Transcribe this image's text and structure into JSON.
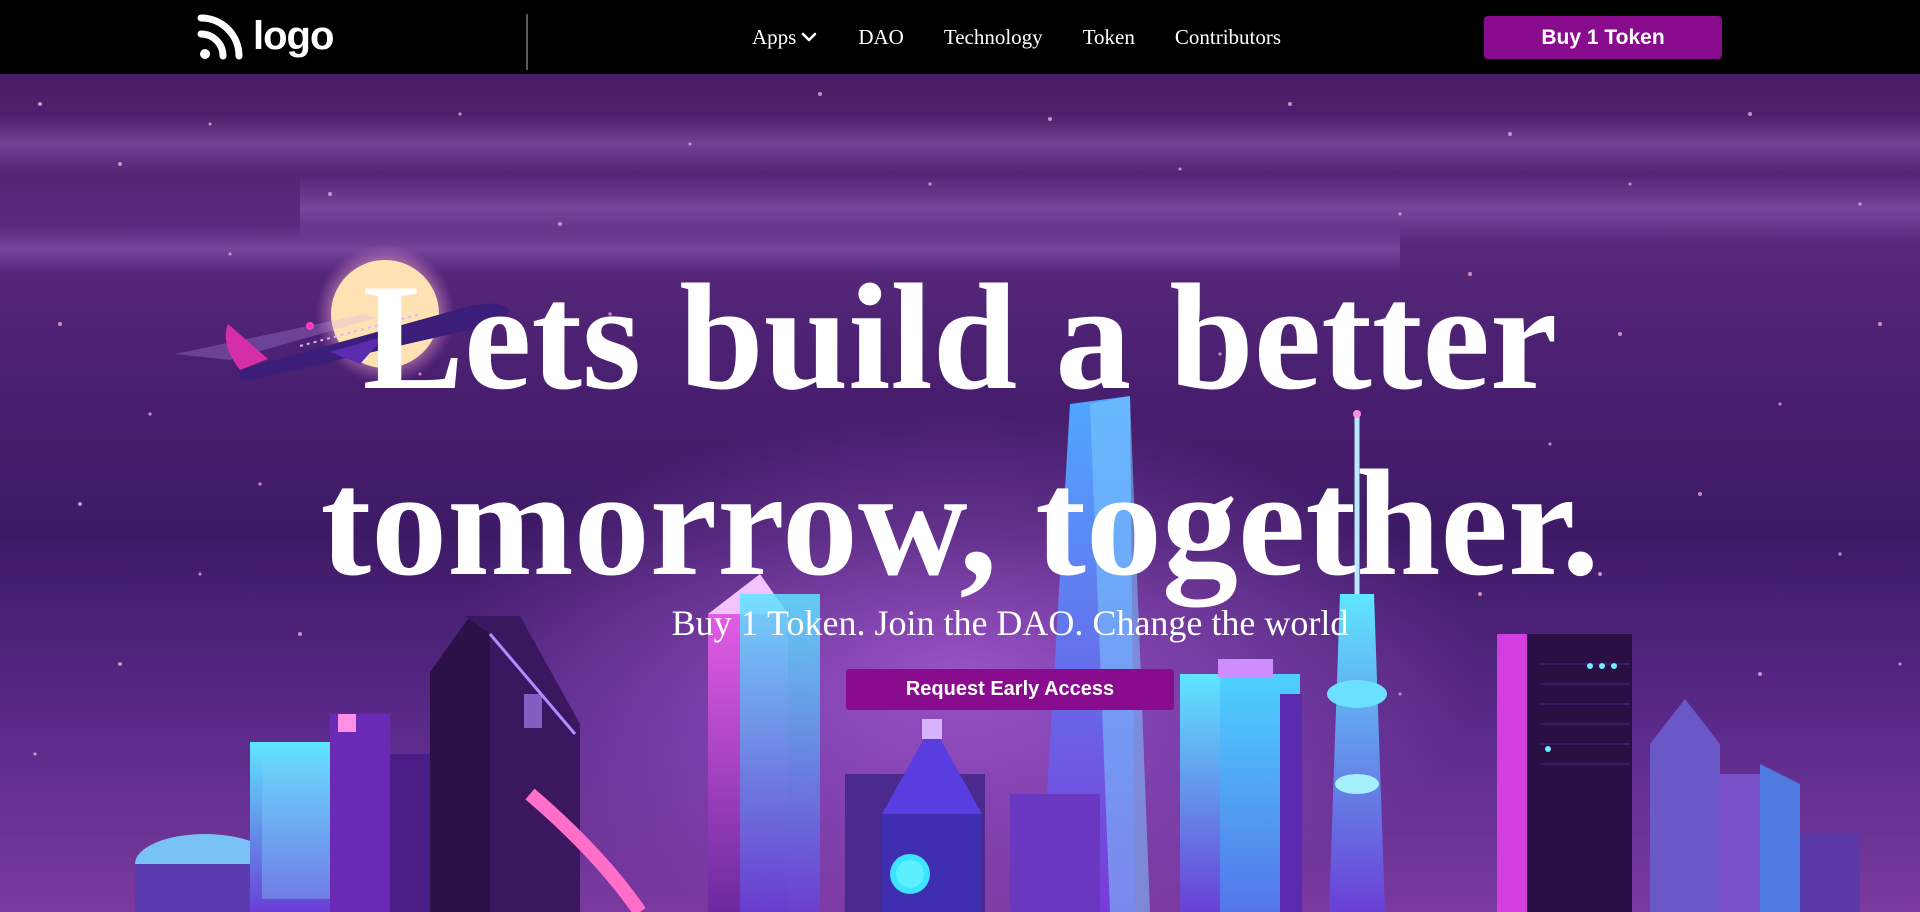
{
  "nav": {
    "logo_text": "logo",
    "links": [
      {
        "label": "Apps",
        "has_dropdown": true
      },
      {
        "label": "DAO"
      },
      {
        "label": "Technology"
      },
      {
        "label": "Token"
      },
      {
        "label": "Contributors"
      }
    ],
    "cta_label": "Buy 1 Token"
  },
  "hero": {
    "headline_line1": "Lets build a better",
    "headline_line2": "tomorrow, together.",
    "subheadline": "Buy 1 Token. Join the DAO. Change the world",
    "cta_label": "Request Early Access"
  },
  "colors": {
    "accent": "#8a0c8e",
    "nav_bg": "#000000",
    "text": "#ffffff"
  },
  "icons": {
    "logo": "rss-like-logo-icon",
    "dropdown": "chevron-down-icon"
  }
}
